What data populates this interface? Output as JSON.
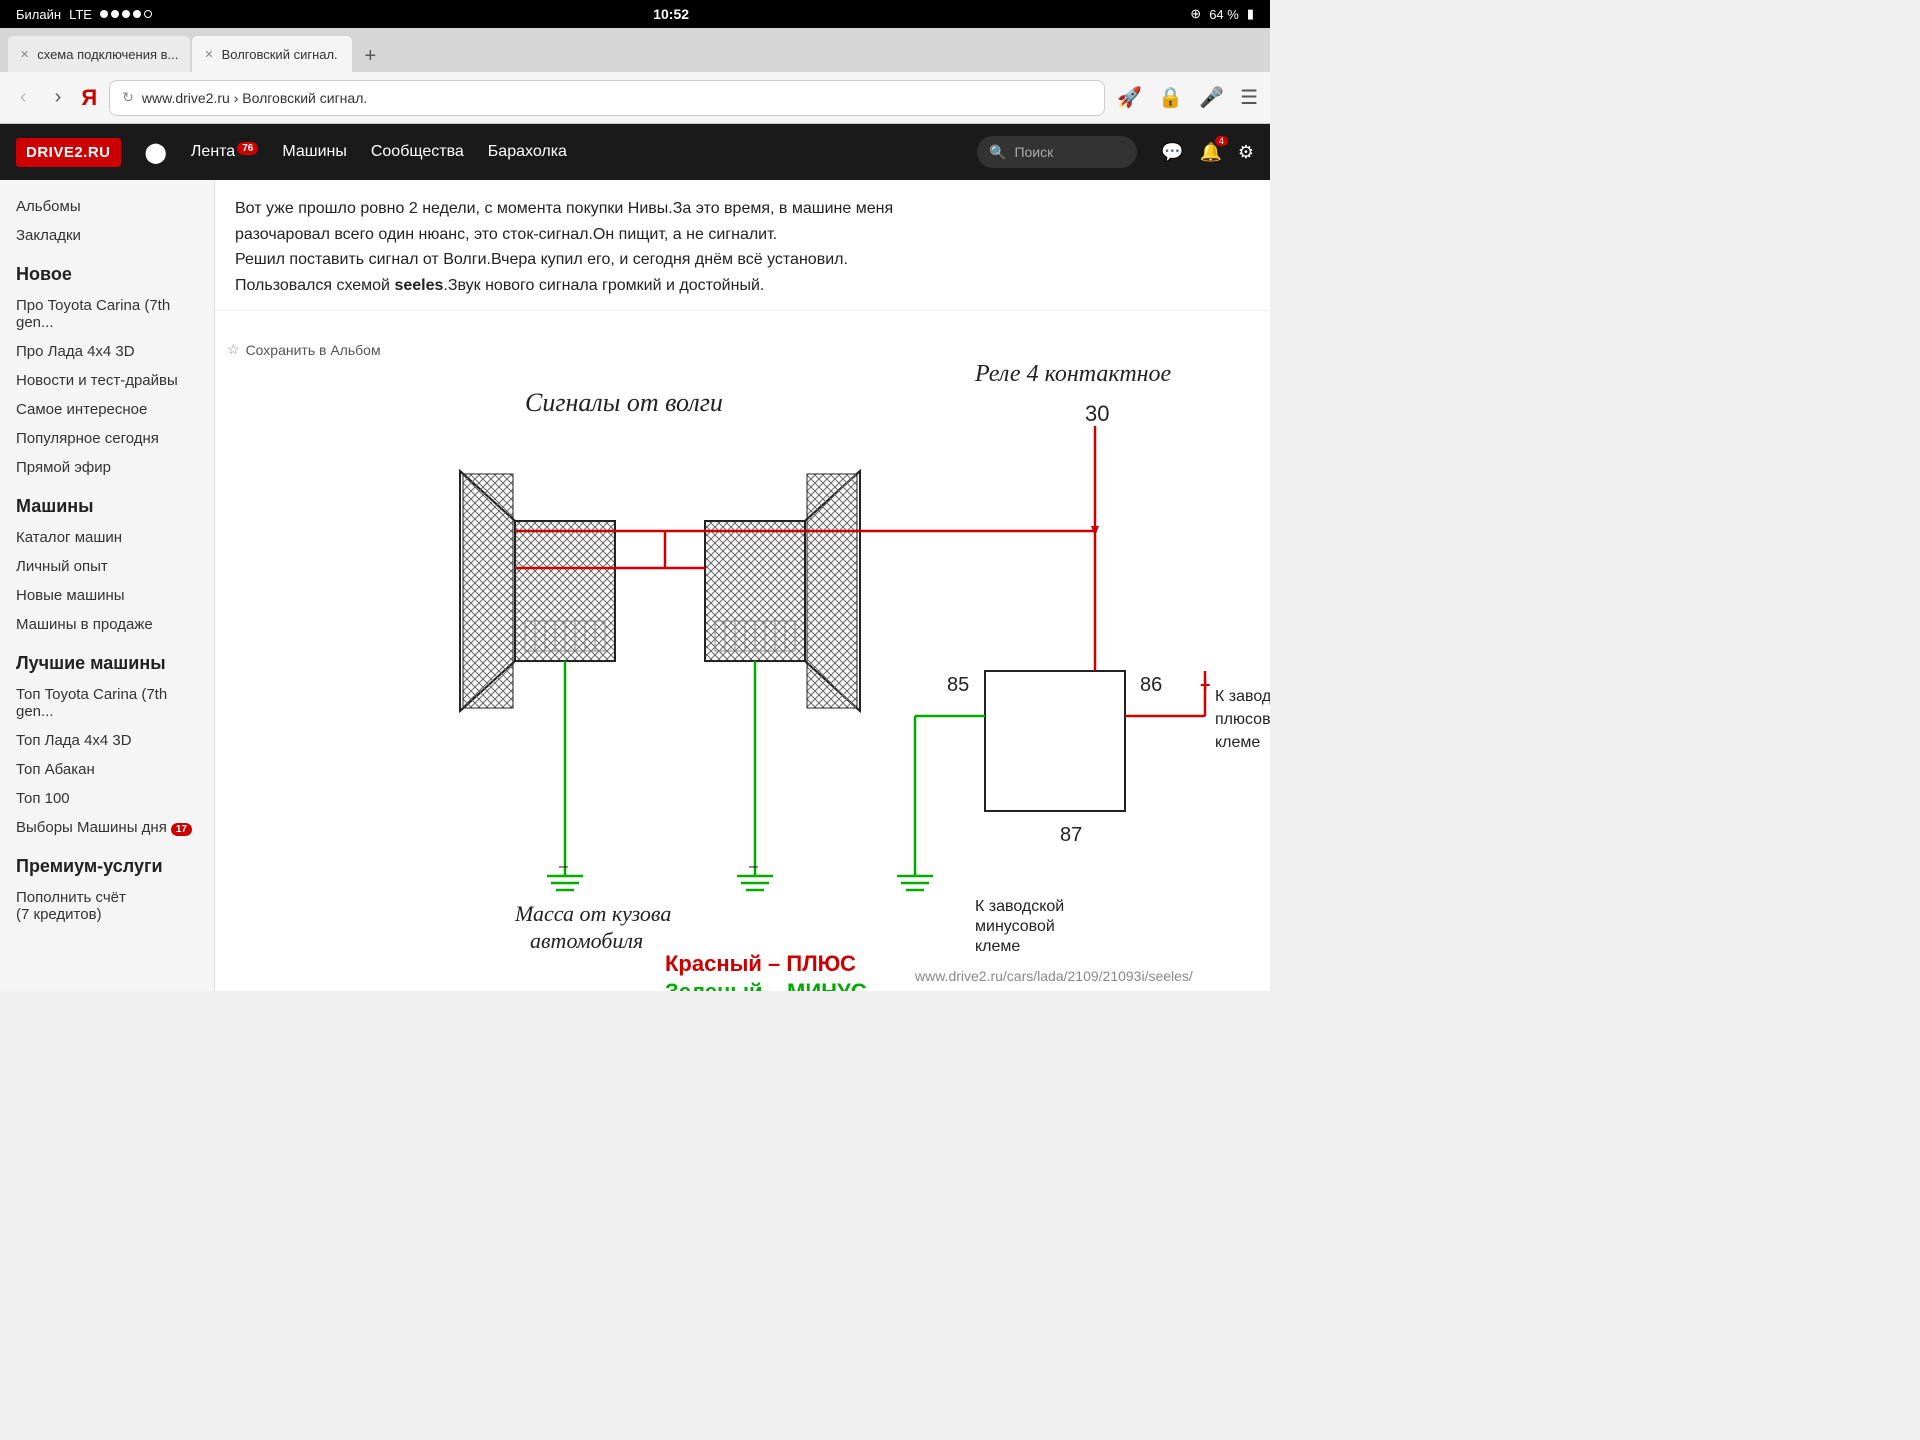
{
  "status_bar": {
    "carrier": "Билайн",
    "network": "LTE",
    "time": "10:52",
    "battery_percent": "64 %",
    "wifi_dots": 4
  },
  "browser": {
    "tabs": [
      {
        "id": 1,
        "label": "схема подключения в...",
        "active": false
      },
      {
        "id": 2,
        "label": "Волговский сигнал.",
        "active": true
      }
    ],
    "new_tab_label": "+",
    "back_label": "‹",
    "forward_label": "›",
    "yandex_label": "Я",
    "url": "www.drive2.ru › Волговский сигнал.",
    "url_full": "www.drive2.ru",
    "url_breadcrumb": "Волговский сигнал.",
    "reload_icon": "↻",
    "share_icon": "🚀",
    "lock_icon": "🔒",
    "mic_icon": "🎤",
    "menu_icon": "☰"
  },
  "site_header": {
    "logo": "DRIVE2.RU",
    "nav_items": [
      {
        "label": "Лента",
        "badge": "76"
      },
      {
        "label": "Машины",
        "badge": null
      },
      {
        "label": "Сообщества",
        "badge": null
      },
      {
        "label": "Барахолка",
        "badge": null
      }
    ],
    "search_placeholder": "Поиск",
    "notification_badge": "4"
  },
  "sidebar": {
    "top_links": [
      {
        "label": "Альбомы"
      },
      {
        "label": "Закладки"
      }
    ],
    "sections": [
      {
        "title": "Новое",
        "items": [
          {
            "label": "Про Toyota Carina (7th gen..."
          },
          {
            "label": "Про Лада 4x4 3D"
          },
          {
            "label": "Новости и тест-драйвы"
          },
          {
            "label": "Самое интересное"
          },
          {
            "label": "Популярное сегодня"
          },
          {
            "label": "Прямой эфир"
          }
        ]
      },
      {
        "title": "Машины",
        "items": [
          {
            "label": "Каталог машин"
          },
          {
            "label": "Личный опыт"
          },
          {
            "label": "Новые машины"
          },
          {
            "label": "Машины в продаже"
          }
        ]
      },
      {
        "title": "Лучшие машины",
        "items": [
          {
            "label": "Топ Toyota Carina (7th gen..."
          },
          {
            "label": "Топ Лада 4x4 3D"
          },
          {
            "label": "Топ Абакан"
          },
          {
            "label": "Топ 100"
          },
          {
            "label": "Выборы Машины дня",
            "badge": "17"
          }
        ]
      },
      {
        "title": "Премиум-услуги",
        "items": [
          {
            "label": "Пополнить счёт\n(7 кредитов)"
          }
        ]
      }
    ]
  },
  "article": {
    "text_lines": [
      "Вот уже прошло ровно 2 недели, с момента покупки Нивы.За это время, в машине меня",
      "разочаровал всего один нюанс, это сток-сигнал.Он пищит, а не сигналит.",
      "Решил поставить сигнал от Волги.Вчера купил его, и сегодня днём всё установил.",
      "Пользовался схемой seeles.Звук нового сигнала громкий и достойный."
    ],
    "bold_word": "seeles"
  },
  "diagram": {
    "save_label": "Сохранить в Альбом",
    "title_signals": "Сигналы от волги",
    "label_relay": "Реле 4 контактное",
    "label_30": "30",
    "label_85": "85",
    "label_86": "86",
    "label_87": "87",
    "label_plus_sign": "+",
    "label_mass": "Масса от кузова\nавтомобиля",
    "label_minus_factory": "К заводской\nминусовой\nклеме",
    "label_plus_factory": "К заводской\nплюсовой\nклемe",
    "label_red": "Красный – ПЛЮС",
    "label_green": "Зеленый – МИНУС",
    "watermark": "www.drive2.ru/cars/lada/2109/21093i/seeles/"
  },
  "icons": {
    "star": "☆",
    "search": "🔍",
    "bell": "🔔",
    "chat": "💬",
    "gear": "⚙"
  }
}
